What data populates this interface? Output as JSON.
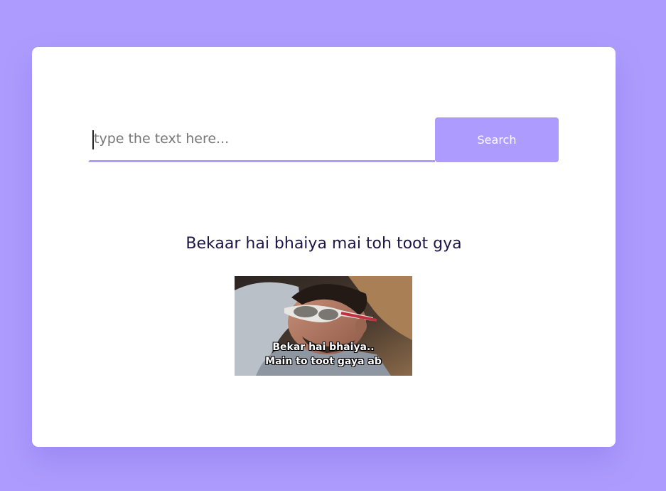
{
  "search": {
    "placeholder": "type the text here...",
    "value": "",
    "button_label": "Search"
  },
  "result": {
    "title": "Bekaar hai bhaiya mai toh toot gya",
    "image_caption_line1": "Bekar hai bhaiya..",
    "image_caption_line2": "Main to toot gaya ab"
  },
  "colors": {
    "background": "#ad9cfd",
    "accent": "#ad9cfd",
    "card": "#ffffff",
    "title_text": "#1c1646"
  }
}
